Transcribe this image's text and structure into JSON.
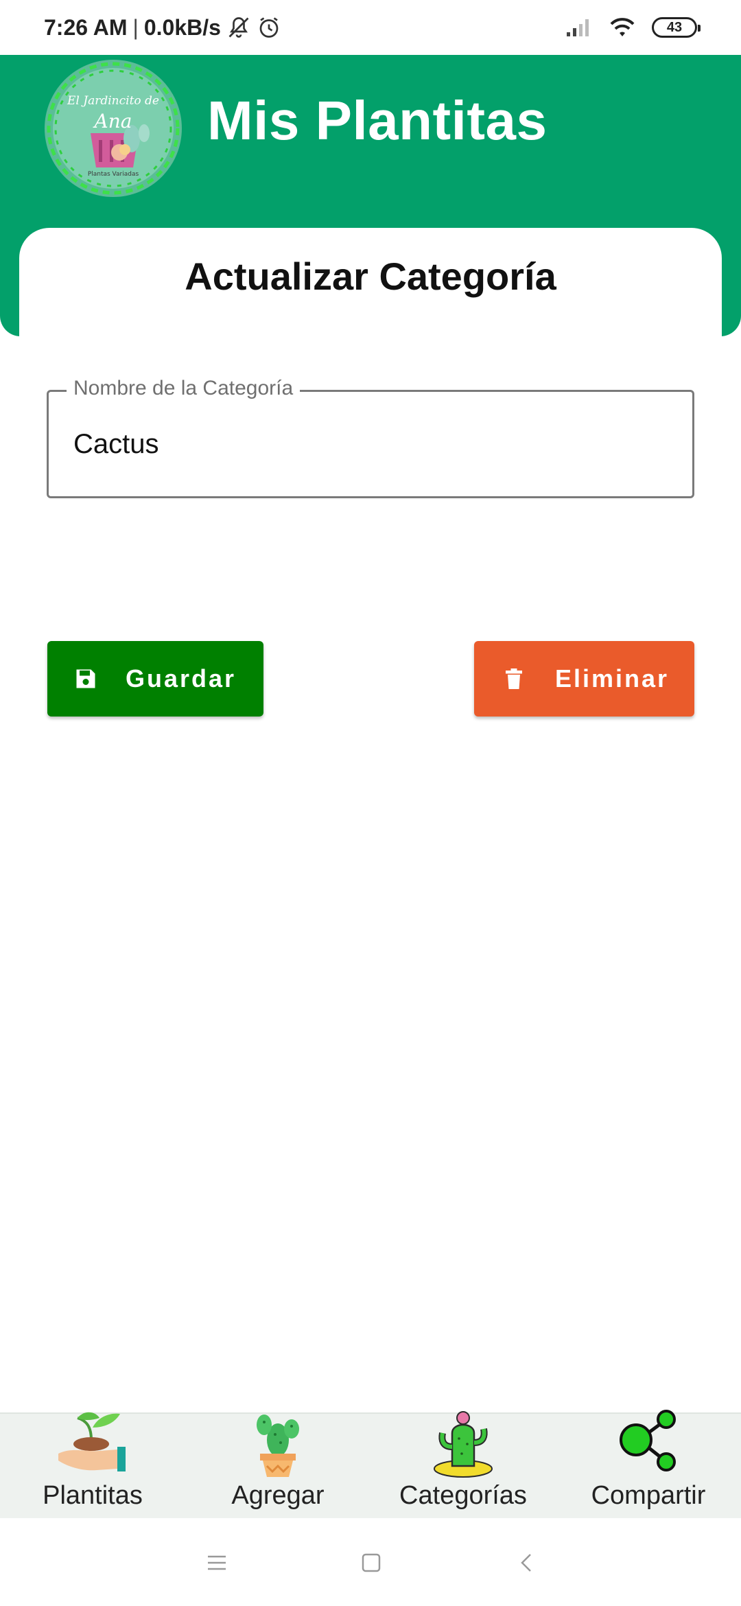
{
  "status_bar": {
    "time": "7:26 AM",
    "separator": "|",
    "net_speed": "0.0kB/s",
    "battery": "43",
    "icons": [
      "mute-icon",
      "alarm-icon",
      "signal-icon",
      "wifi-icon",
      "battery-icon"
    ]
  },
  "header": {
    "title": "Mis Plantitas",
    "logo_alt_text": "El Jardincito de Ana — Plantas Variadas"
  },
  "card": {
    "title": "Actualizar Categoría"
  },
  "form": {
    "category_field": {
      "label": "Nombre de la Categoría",
      "value": "Cactus"
    }
  },
  "actions": {
    "save_label": "Guardar",
    "delete_label": "Eliminar"
  },
  "bottom_nav": {
    "items": [
      {
        "label": "Plantitas",
        "icon": "plant-hand-icon"
      },
      {
        "label": "Agregar",
        "icon": "potted-cactus-icon"
      },
      {
        "label": "Categorías",
        "icon": "cactus-flower-icon"
      },
      {
        "label": "Compartir",
        "icon": "share-icon"
      }
    ]
  },
  "colors": {
    "primary": "#03a06a",
    "save": "#008000",
    "delete": "#ea5b2b",
    "nav_background": "#eef2ef"
  }
}
